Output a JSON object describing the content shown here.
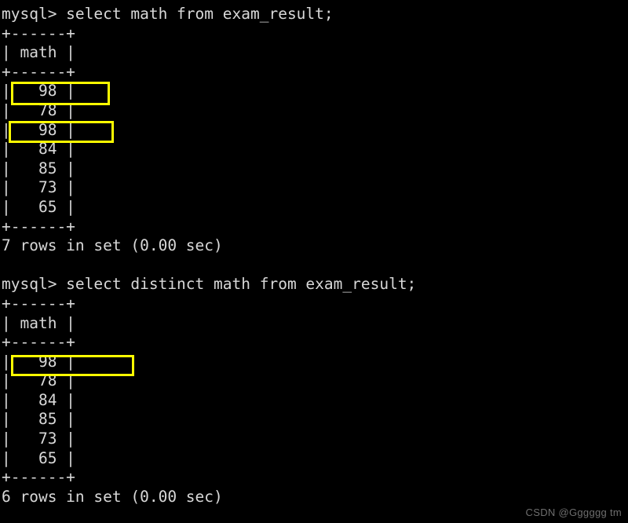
{
  "terminal": {
    "background_color": "#000000",
    "text_color": "#d8d8d8",
    "highlight_color": "#ffff00",
    "lines": [
      "mysql> select math from exam_result;",
      "+------+",
      "| math |",
      "+------+",
      "|   98 |",
      "|   78 |",
      "|   98 |",
      "|   84 |",
      "|   85 |",
      "|   73 |",
      "|   65 |",
      "+------+",
      "7 rows in set (0.00 sec)",
      "",
      "mysql> select distinct math from exam_result;",
      "+------+",
      "| math |",
      "+------+",
      "|   98 |",
      "|   78 |",
      "|   84 |",
      "|   85 |",
      "|   73 |",
      "|   65 |",
      "+------+",
      "6 rows in set (0.00 sec)"
    ],
    "queries": [
      {
        "prompt": "mysql>",
        "statement": "select math from exam_result;",
        "result_column": "math",
        "result_values": [
          "98",
          "78",
          "98",
          "84",
          "85",
          "73",
          "65"
        ],
        "status": "7 rows in set (0.00 sec)",
        "row_count": "7",
        "duration": "0.00 sec"
      },
      {
        "prompt": "mysql>",
        "statement": "select distinct math from exam_result;",
        "result_column": "math",
        "result_values": [
          "98",
          "78",
          "84",
          "85",
          "73",
          "65"
        ],
        "status": "6 rows in set (0.00 sec)",
        "row_count": "6",
        "duration": "0.00 sec"
      }
    ],
    "highlights": [
      {
        "label": "duplicate value 98 first occurrence",
        "value": "98"
      },
      {
        "label": "duplicate value 98 second occurrence",
        "value": "98"
      },
      {
        "label": "deduplicated value 98",
        "value": "98"
      }
    ]
  },
  "watermark": {
    "text": "CSDN @Gggggg tm"
  }
}
